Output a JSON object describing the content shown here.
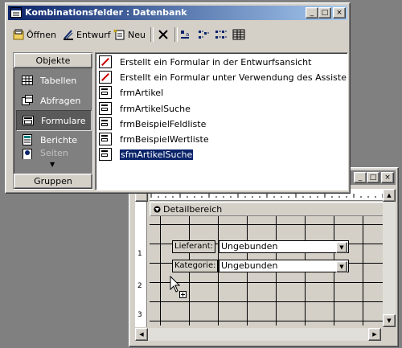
{
  "db_window": {
    "title": "Kombinationsfelder : Datenbank",
    "controls": {
      "minimize": "_",
      "maximize": "□",
      "close": "×"
    }
  },
  "toolbar": {
    "open_label": "Öffnen",
    "design_label": "Entwurf",
    "new_label": "Neu",
    "delete_icon": "delete-icon",
    "view_icons": [
      "large-icons-icon",
      "small-icons-icon",
      "list-icon",
      "details-icon"
    ]
  },
  "objects_bar": {
    "header": "Objekte",
    "items": [
      {
        "label": "Tabellen",
        "icon": "table-icon",
        "selected": false
      },
      {
        "label": "Abfragen",
        "icon": "query-icon",
        "selected": false
      },
      {
        "label": "Formulare",
        "icon": "form-icon",
        "selected": true
      },
      {
        "label": "Berichte",
        "icon": "report-icon",
        "selected": false
      },
      {
        "label": "Seiten",
        "icon": "page-icon",
        "selected": false
      }
    ],
    "groups": "Gruppen"
  },
  "object_list": [
    {
      "label": "Erstellt ein Formular in der Entwurfsansicht",
      "icon": "design-wizard-icon",
      "selected": false
    },
    {
      "label": "Erstellt ein Formular unter Verwendung des Assistenten",
      "icon": "form-wizard-icon",
      "selected": false
    },
    {
      "label": "frmArtikel",
      "icon": "form-icon",
      "selected": false
    },
    {
      "label": "frmArtikelSuche",
      "icon": "form-icon",
      "selected": false
    },
    {
      "label": "frmBeispielFeldliste",
      "icon": "form-icon",
      "selected": false
    },
    {
      "label": "frmBeispielWertliste",
      "icon": "form-icon",
      "selected": false
    },
    {
      "label": "sfmArtikelSuche",
      "icon": "form-icon",
      "selected": true
    }
  ],
  "form_designer": {
    "section": "Detailbereich",
    "controls": [
      {
        "label": "Lieferant:",
        "value": "Ungebunden"
      },
      {
        "label": "Kategorie:",
        "value": "Ungebunden"
      }
    ],
    "ruler_left": [
      "1",
      "2",
      "3"
    ]
  }
}
